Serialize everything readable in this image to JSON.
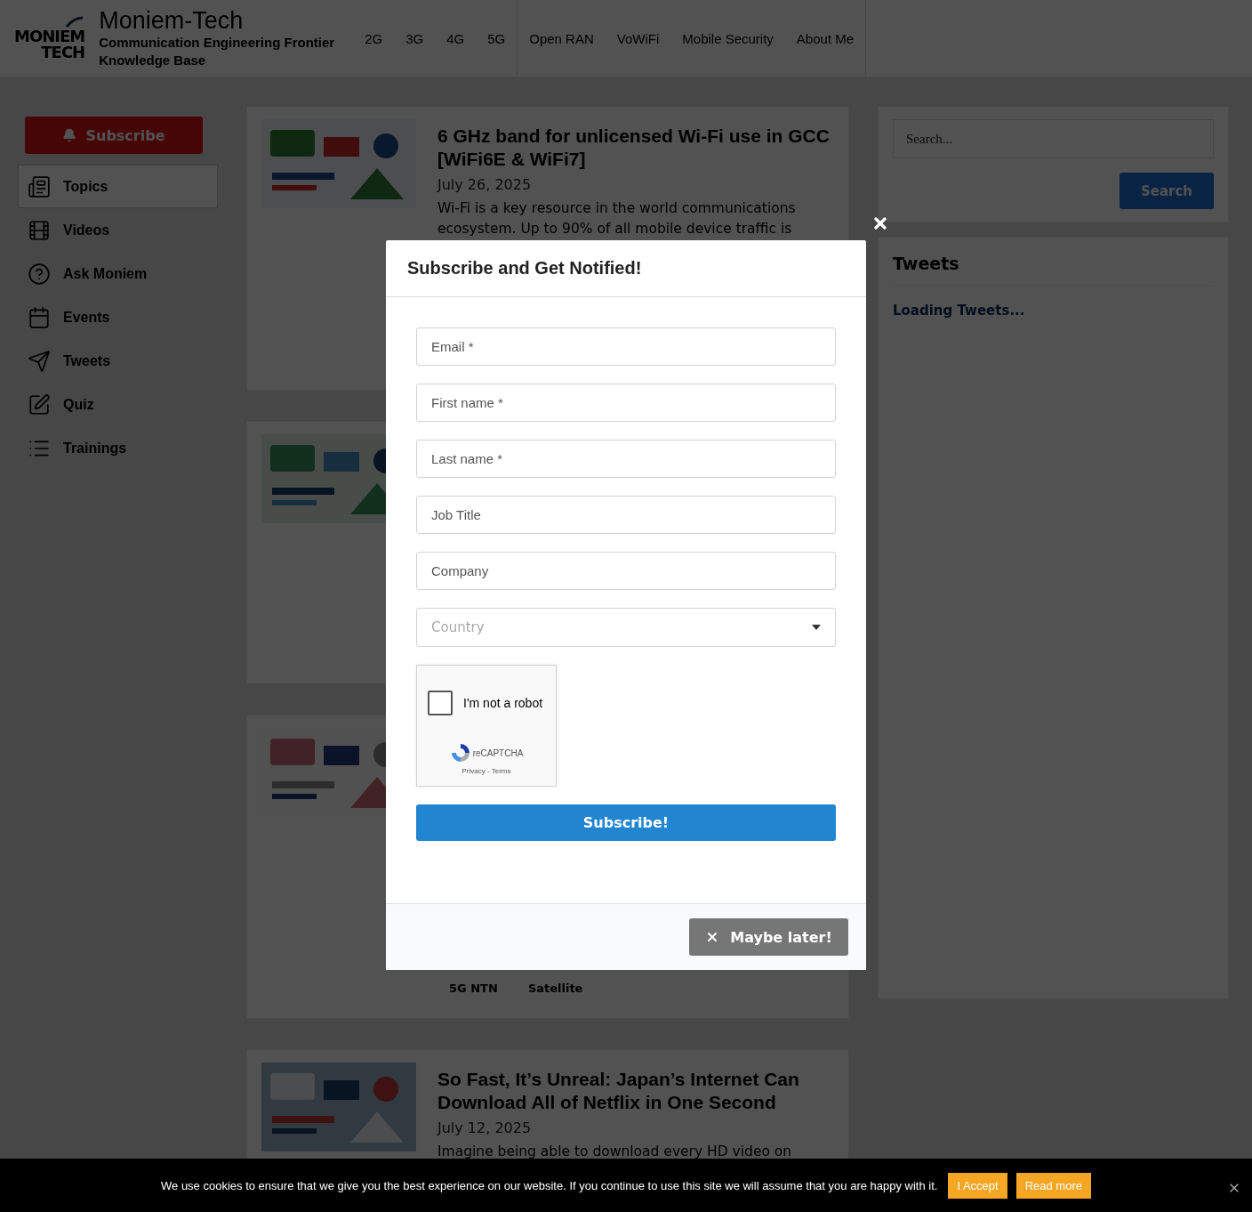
{
  "header": {
    "logo": [
      "MONIEM",
      "TECH"
    ],
    "title": "Moniem-Tech",
    "tagline": "Communication Engineering Frontier Knowledge Base",
    "nav": [
      "2G",
      "3G",
      "4G",
      "5G",
      "Open RAN",
      "VoWiFi",
      "Mobile Security",
      "About Me"
    ]
  },
  "sidebar": {
    "subscribe": "Subscribe",
    "items": [
      {
        "label": "Topics",
        "selected": true
      },
      {
        "label": "Videos",
        "selected": false
      },
      {
        "label": "Ask Moniem",
        "selected": false
      },
      {
        "label": "Events",
        "selected": false
      },
      {
        "label": "Tweets",
        "selected": false
      },
      {
        "label": "Quiz",
        "selected": false
      },
      {
        "label": "Trainings",
        "selected": false
      }
    ]
  },
  "articles": [
    {
      "image": {
        "kind": "picture"
      },
      "title": "6 GHz band for unlicensed Wi-Fi use in GCC [WiFi6E & WiFi7]",
      "date": "July 26, 2025",
      "excerpt": "Wi-Fi is a key resource in the world communications ecosystem. Up to 90% of all mobile device traffic is"
    },
    {
      "image": {
        "kind": "picture"
      }
    },
    {
      "image": {
        "kind": "picture"
      },
      "tags": [
        "5G NTN",
        "Satellite"
      ]
    },
    {
      "image": {
        "kind": "picture"
      },
      "title": "So Fast, It’s Unreal: Japan’s Internet Can Download All of Netflix in One Second",
      "date": "July 12, 2025",
      "excerpt": "Imagine being able to download every HD video on"
    }
  ],
  "search": {
    "placeholder": "Search...",
    "button": "Search"
  },
  "tweets": {
    "title": "Tweets",
    "status": "Loading Tweets..."
  },
  "modal": {
    "title": "Subscribe and Get Notified!",
    "fields": [
      {
        "kind": "text",
        "placeholder": "Email *"
      },
      {
        "kind": "text",
        "placeholder": "First name *"
      },
      {
        "kind": "text",
        "placeholder": "Last name *"
      },
      {
        "kind": "text",
        "placeholder": "Job Title"
      },
      {
        "kind": "text",
        "placeholder": "Company"
      },
      {
        "kind": "select",
        "placeholder": "Country"
      }
    ],
    "captcha": {
      "label": "I'm not a robot",
      "checked": false,
      "brand": "reCAPTCHA",
      "links": "Privacy - Terms"
    },
    "submit": "Subscribe!",
    "dismiss": "Maybe later!"
  },
  "cookie": {
    "text": "We use cookies to ensure that we give you the best experience on our website. If you continue to use this site we will assume that you are happy with it.",
    "buttons": [
      "I Accept",
      "Read more"
    ]
  }
}
